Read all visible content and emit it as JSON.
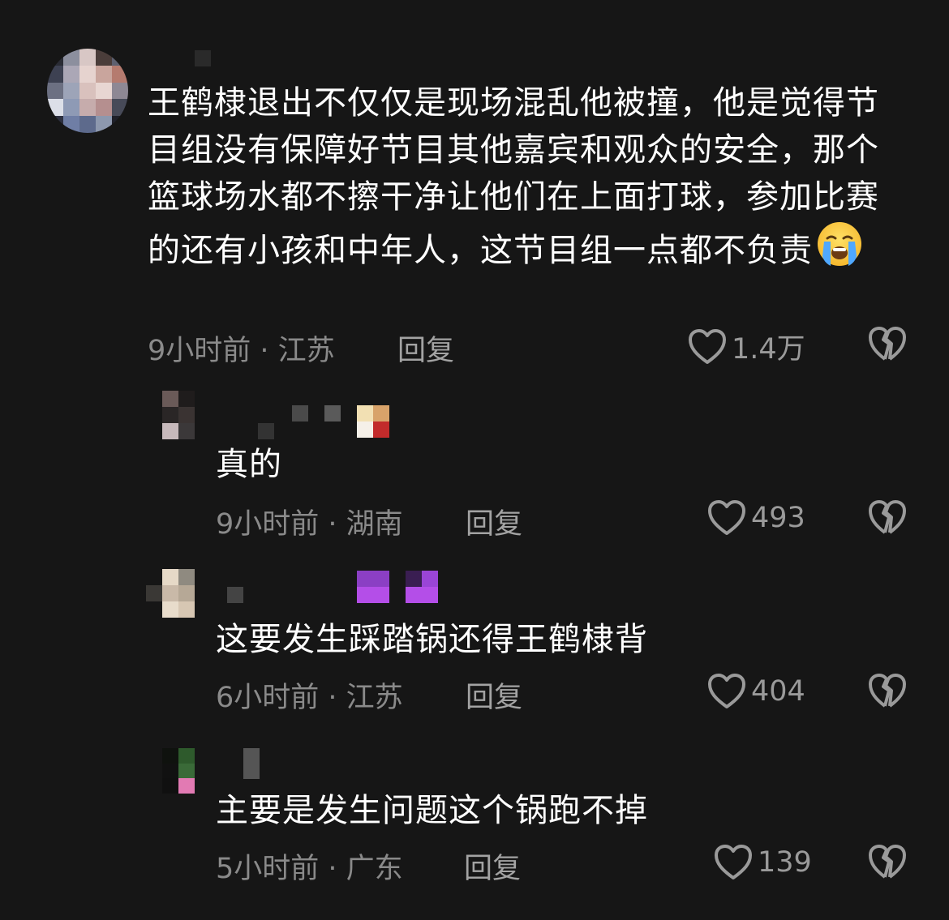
{
  "comments": [
    {
      "text": "王鹤棣退出不仅仅是现场混乱他被撞，他是觉得节目组没有保障好节目其他嘉宾和观众的安全，那个篮球场水都不擦干净让他们在上面打球，参加比赛的还有小孩和中年人，这节目组一点都不负责",
      "emoji": "loudly-crying-face",
      "time": "9小时前 · 江苏",
      "reply_label": "回复",
      "likes": "1.4万"
    },
    {
      "text": "真的",
      "time": "9小时前 · 湖南",
      "reply_label": "回复",
      "likes": "493"
    },
    {
      "text": "这要发生踩踏锅还得王鹤棣背",
      "time": "6小时前 · 江苏",
      "reply_label": "回复",
      "likes": "404"
    },
    {
      "text": "主要是发生问题这个锅跑不掉",
      "time": "5小时前 · 广东",
      "reply_label": "回复",
      "likes": "139"
    }
  ],
  "icons": {
    "like": "heart-outline-icon",
    "dislike": "broken-heart-icon"
  },
  "colors": {
    "background": "#161616",
    "text": "#ffffff",
    "meta": "#8a8a8a"
  }
}
